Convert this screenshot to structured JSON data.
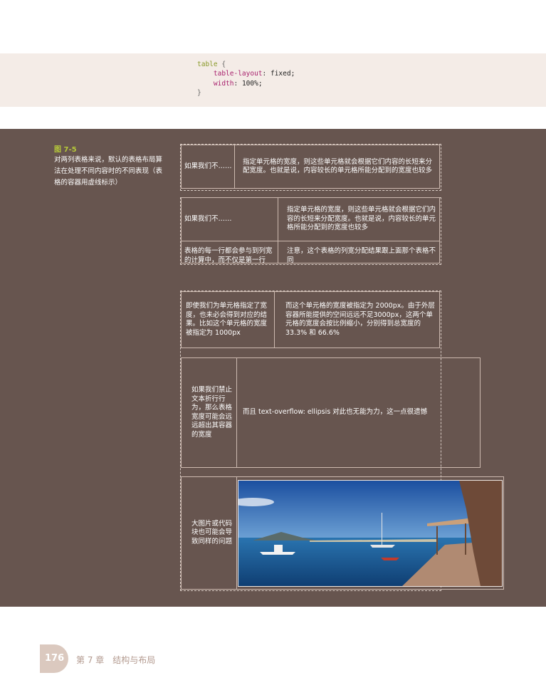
{
  "code": {
    "selector": "table",
    "open_brace": "{",
    "prop1": "table-layout",
    "val1": "fixed;",
    "prop2": "width",
    "val2": "100%;",
    "close_brace": "}"
  },
  "figure": {
    "label": "图 7-5",
    "caption": "对两列表格来说，默认的表格布局算法在处理不同内容时的不同表现（表格的容器用虚线标示）"
  },
  "tables": {
    "t1": {
      "left": "如果我们不……",
      "right": "指定单元格的宽度，则这些单元格就会根据它们内容的长短来分配宽度。也就是说，内容较长的单元格所能分配到的宽度也较多"
    },
    "t2": {
      "r1_left": "如果我们不……",
      "r1_right": "指定单元格的宽度，则这些单元格就会根据它们内容的长短来分配宽度。也就是说，内容较长的单元格所能分配到的宽度也较多",
      "r2_left": "表格的每一行都会参与到列宽的计算中，而不仅是第一行",
      "r2_right": "注意，这个表格的列宽分配结果跟上面那个表格不同"
    },
    "t3": {
      "left": "即使我们为单元格指定了宽度，也未必会得到对应的结果。比如这个单元格的宽度被指定为 1000px",
      "right": "而这个单元格的宽度被指定为 2000px。由于外层容器所能提供的空间远远不足3000px，这两个单元格的宽度会按比例缩小，分别得到总宽度的 33.3% 和 66.6%"
    },
    "t4": {
      "left": "如果我们禁止文本折行行为，那么表格宽度可能会远远超出其容器的宽度",
      "right": "而且 text-overflow: ellipsis 对此也无能为力，这一点很遗憾"
    },
    "t5": {
      "left": "大图片或代码块也可能会导致同样的问题"
    }
  },
  "footer": {
    "page_number": "176",
    "chapter": "第 7 章　结构与布局"
  },
  "colors": {
    "dark_bg": "#67554f",
    "code_bg": "#f4ece7",
    "accent_green": "#b6c93a"
  }
}
